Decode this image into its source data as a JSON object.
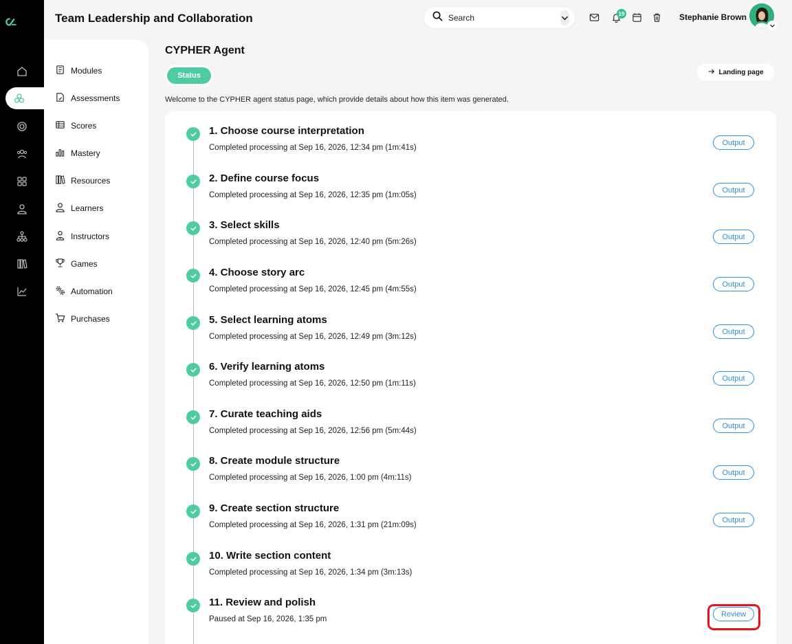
{
  "app": {
    "title": "Team Leadership and Collaboration"
  },
  "header": {
    "search_placeholder": "Search",
    "notification_count": "19",
    "user_name": "Stephanie Brown"
  },
  "rail": {
    "items": [
      "home",
      "modules",
      "target",
      "users",
      "apps",
      "learner",
      "network",
      "library",
      "analytics"
    ]
  },
  "sidebar": {
    "items": [
      {
        "label": "Modules",
        "icon": "book-icon"
      },
      {
        "label": "Assessments",
        "icon": "document-icon"
      },
      {
        "label": "Scores",
        "icon": "table-icon"
      },
      {
        "label": "Mastery",
        "icon": "bar-chart-icon"
      },
      {
        "label": "Resources",
        "icon": "library-icon"
      },
      {
        "label": "Learners",
        "icon": "person-icon"
      },
      {
        "label": "Instructors",
        "icon": "instructor-icon"
      },
      {
        "label": "Games",
        "icon": "trophy-icon"
      },
      {
        "label": "Automation",
        "icon": "gears-icon"
      },
      {
        "label": "Purchases",
        "icon": "cart-icon"
      }
    ]
  },
  "main": {
    "title": "CYPHER Agent",
    "tab_status": "Status",
    "landing_label": "Landing page",
    "welcome": "Welcome to the CYPHER agent status page, which provide details about how this item was generated.",
    "steps": [
      {
        "title": "1. Choose course interpretation",
        "detail": "Completed processing at Sep 16, 2026, 12:34 pm (1m:41s)",
        "button": "Output"
      },
      {
        "title": "2. Define course focus",
        "detail": "Completed processing at Sep 16, 2026, 12:35 pm (1m:05s)",
        "button": "Output"
      },
      {
        "title": "3. Select skills",
        "detail": "Completed processing at Sep 16, 2026, 12:40 pm (5m:26s)",
        "button": "Output"
      },
      {
        "title": "4. Choose story arc",
        "detail": "Completed processing at Sep 16, 2026, 12:45 pm (4m:55s)",
        "button": "Output"
      },
      {
        "title": "5. Select learning atoms",
        "detail": "Completed processing at Sep 16, 2026, 12:49 pm (3m:12s)",
        "button": "Output"
      },
      {
        "title": "6. Verify learning atoms",
        "detail": "Completed processing at Sep 16, 2026, 12:50 pm (1m:11s)",
        "button": "Output"
      },
      {
        "title": "7. Curate teaching aids",
        "detail": "Completed processing at Sep 16, 2026, 12:56 pm (5m:44s)",
        "button": "Output"
      },
      {
        "title": "8. Create module structure",
        "detail": "Completed processing at Sep 16, 2026, 1:00 pm (4m:11s)",
        "button": "Output"
      },
      {
        "title": "9. Create section structure",
        "detail": "Completed processing at Sep 16, 2026, 1:31 pm (21m:09s)",
        "button": "Output"
      },
      {
        "title": "10. Write section content",
        "detail": "Completed processing at Sep 16, 2026, 1:34 pm (3m:13s)",
        "button": ""
      },
      {
        "title": "11. Review and polish",
        "detail": "Paused at Sep 16, 2026, 1:35 pm",
        "button": "Review"
      }
    ]
  },
  "colors": {
    "accent": "#4ecca0",
    "link": "#2d8fd5",
    "highlight": "#e8111c"
  }
}
